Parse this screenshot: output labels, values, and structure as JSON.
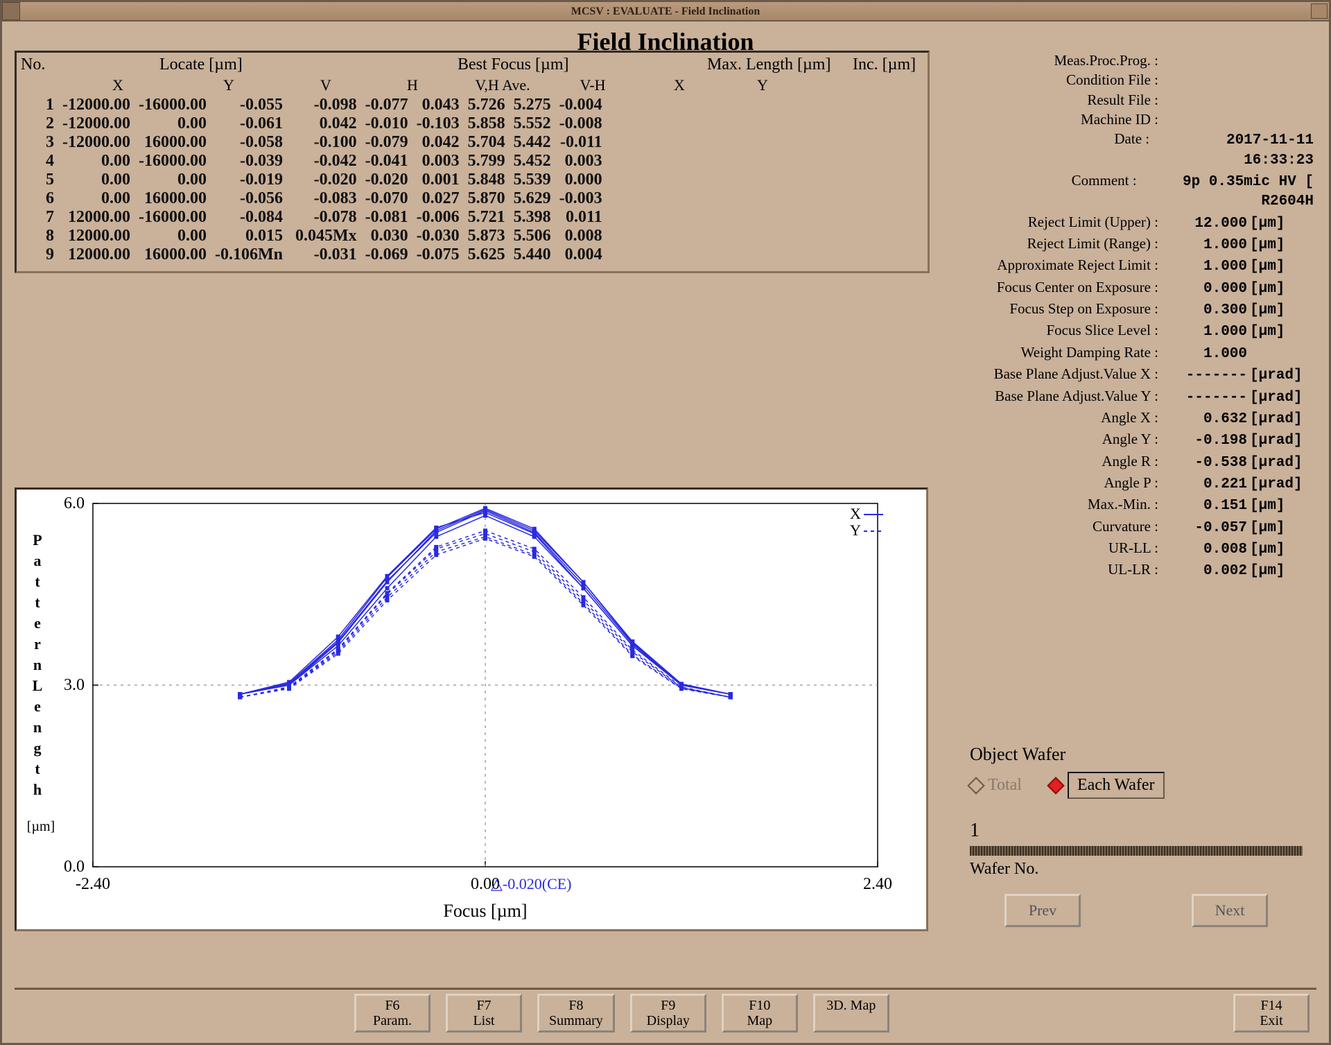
{
  "window_title": "MCSV : EVALUATE - Field Inclination",
  "page_title": "Field Inclination",
  "group_headers": {
    "no": "No.",
    "locate": "Locate [µm]",
    "best_focus": "Best Focus [µm]",
    "max_length": "Max. Length [µm]",
    "inc": "Inc. [µm]"
  },
  "col_headers": {
    "x1": "X",
    "y1": "Y",
    "v": "V",
    "h": "H",
    "vhave": "V,H Ave.",
    "vmh": "V-H",
    "x2": "X",
    "y2": "Y"
  },
  "table_rows": [
    {
      "no": "1",
      "lx": "-12000.00",
      "ly": "-16000.00",
      "v": "-0.055",
      "h": "-0.098",
      "vhave": "-0.077",
      "vmh": " 0.043",
      "mx": "5.726",
      "my": "5.275",
      "inc": "-0.004"
    },
    {
      "no": "2",
      "lx": "-12000.00",
      "ly": "     0.00",
      "v": "-0.061",
      "h": " 0.042",
      "vhave": "-0.010",
      "vmh": "-0.103",
      "mx": "5.858",
      "my": "5.552",
      "inc": "-0.008"
    },
    {
      "no": "3",
      "lx": "-12000.00",
      "ly": " 16000.00",
      "v": "-0.058",
      "h": "-0.100",
      "vhave": "-0.079",
      "vmh": " 0.042",
      "mx": "5.704",
      "my": "5.442",
      "inc": "-0.011"
    },
    {
      "no": "4",
      "lx": "     0.00",
      "ly": "-16000.00",
      "v": "-0.039",
      "h": "-0.042",
      "vhave": "-0.041",
      "vmh": " 0.003",
      "mx": "5.799",
      "my": "5.452",
      "inc": " 0.003"
    },
    {
      "no": "5",
      "lx": "     0.00",
      "ly": "     0.00",
      "v": "-0.019",
      "h": "-0.020",
      "vhave": "-0.020",
      "vmh": " 0.001",
      "mx": "5.848",
      "my": "5.539",
      "inc": " 0.000"
    },
    {
      "no": "6",
      "lx": "     0.00",
      "ly": " 16000.00",
      "v": "-0.056",
      "h": "-0.083",
      "vhave": "-0.070",
      "vmh": " 0.027",
      "mx": "5.870",
      "my": "5.629",
      "inc": "-0.003"
    },
    {
      "no": "7",
      "lx": " 12000.00",
      "ly": "-16000.00",
      "v": "-0.084",
      "h": "-0.078",
      "vhave": "-0.081",
      "vmh": "-0.006",
      "mx": "5.721",
      "my": "5.398",
      "inc": " 0.011"
    },
    {
      "no": "8",
      "lx": " 12000.00",
      "ly": "     0.00",
      "v": " 0.015",
      "h": " 0.045Mx",
      "vhave": " 0.030",
      "vmh": "-0.030",
      "mx": "5.873",
      "my": "5.506",
      "inc": " 0.008"
    },
    {
      "no": "9",
      "lx": " 12000.00",
      "ly": " 16000.00",
      "v": "-0.106Mn",
      "h": "-0.031",
      "vhave": "-0.069",
      "vmh": "-0.075",
      "mx": "5.625",
      "my": "5.440",
      "inc": " 0.004"
    }
  ],
  "side": [
    {
      "label": "Meas.Proc.Prog. :",
      "value": "",
      "unit": ""
    },
    {
      "label": "Condition File :",
      "value": "",
      "unit": ""
    },
    {
      "label": "Result File :",
      "value": "",
      "unit": ""
    },
    {
      "label": "Machine ID :",
      "value": "",
      "unit": ""
    },
    {
      "label": "Date :",
      "value": "2017-11-11 16:33:23",
      "unit": ""
    },
    {
      "label": "Comment :",
      "value": "9p 0.35mic HV [ R2604H",
      "unit": ""
    },
    {
      "label": "Reject Limit (Upper) :",
      "value": "12.000",
      "unit": "[µm]"
    },
    {
      "label": "Reject Limit (Range) :",
      "value": "1.000",
      "unit": "[µm]"
    },
    {
      "label": "Approximate Reject Limit :",
      "value": "1.000",
      "unit": "[µm]"
    },
    {
      "label": "Focus Center on Exposure :",
      "value": "0.000",
      "unit": "[µm]"
    },
    {
      "label": "Focus Step on Exposure :",
      "value": "0.300",
      "unit": "[µm]"
    },
    {
      "label": "Focus Slice Level :",
      "value": "1.000",
      "unit": "[µm]"
    },
    {
      "label": "Weight Damping Rate :",
      "value": "1.000",
      "unit": ""
    },
    {
      "label": "Base Plane Adjust.Value X :",
      "value": "-------",
      "unit": "[µrad]"
    },
    {
      "label": "Base Plane Adjust.Value Y :",
      "value": "-------",
      "unit": "[µrad]"
    },
    {
      "label": "Angle X :",
      "value": "0.632",
      "unit": "[µrad]"
    },
    {
      "label": "Angle Y :",
      "value": "-0.198",
      "unit": "[µrad]"
    },
    {
      "label": "Angle R :",
      "value": "-0.538",
      "unit": "[µrad]"
    },
    {
      "label": "Angle P :",
      "value": "0.221",
      "unit": "[µrad]"
    },
    {
      "label": "Max.-Min. :",
      "value": "0.151",
      "unit": "[µm]"
    },
    {
      "label": "Curvature :",
      "value": "-0.057",
      "unit": "[µm]"
    },
    {
      "label": "UR-LL :",
      "value": "0.008",
      "unit": "[µm]"
    },
    {
      "label": "UL-LR :",
      "value": "0.002",
      "unit": "[µm]"
    }
  ],
  "object_wafer": {
    "title": "Object Wafer",
    "total": "Total",
    "each": "Each Wafer",
    "selected": "each",
    "wafer_num": "1",
    "wafer_label": "Wafer No.",
    "prev": "Prev",
    "next": "Next"
  },
  "fn_buttons": [
    {
      "key": "F6",
      "label": "Param."
    },
    {
      "key": "F7",
      "label": "List"
    },
    {
      "key": "F8",
      "label": "Summary"
    },
    {
      "key": "F9",
      "label": "Display"
    },
    {
      "key": "F10",
      "label": "Map"
    },
    {
      "key": "",
      "label": "3D. Map"
    }
  ],
  "exit_btn": {
    "key": "F14",
    "label": "Exit"
  },
  "chart_data": {
    "type": "line",
    "title": "",
    "xlabel": "Focus [µm]",
    "ylabel": "Pattern Length",
    "yunit": "[µm]",
    "xlim": [
      -2.4,
      2.4
    ],
    "ylim": [
      0.0,
      6.0
    ],
    "xticks": [
      -2.4,
      0.0,
      2.4
    ],
    "yticks": [
      0.0,
      3.0,
      6.0
    ],
    "center_annotation": "-0.020(CE)",
    "legend": [
      "X",
      "Y"
    ],
    "x": [
      -1.5,
      -1.2,
      -0.9,
      -0.6,
      -0.3,
      0.0,
      0.3,
      0.6,
      0.9,
      1.2,
      1.5
    ],
    "series": [
      {
        "name": "X1",
        "style": "solid",
        "values": [
          2.85,
          3.0,
          3.7,
          4.7,
          5.55,
          5.9,
          5.55,
          4.7,
          3.7,
          3.0,
          2.85
        ]
      },
      {
        "name": "X2",
        "style": "solid",
        "values": [
          2.85,
          3.05,
          3.8,
          4.8,
          5.6,
          5.85,
          5.5,
          4.6,
          3.65,
          3.0,
          2.85
        ]
      },
      {
        "name": "X3",
        "style": "solid",
        "values": [
          2.85,
          3.0,
          3.65,
          4.6,
          5.45,
          5.8,
          5.45,
          4.6,
          3.65,
          3.0,
          2.85
        ]
      },
      {
        "name": "X4",
        "style": "solid",
        "values": [
          2.85,
          3.02,
          3.72,
          4.72,
          5.52,
          5.88,
          5.52,
          4.65,
          3.68,
          3.0,
          2.85
        ]
      },
      {
        "name": "X5",
        "style": "solid",
        "values": [
          2.85,
          3.03,
          3.75,
          4.78,
          5.58,
          5.92,
          5.58,
          4.7,
          3.72,
          3.02,
          2.85
        ]
      },
      {
        "name": "Y1",
        "style": "dash",
        "values": [
          2.8,
          2.95,
          3.55,
          4.45,
          5.2,
          5.45,
          5.15,
          4.35,
          3.5,
          2.95,
          2.8
        ]
      },
      {
        "name": "Y2",
        "style": "dash",
        "values": [
          2.8,
          2.96,
          3.58,
          4.5,
          5.25,
          5.5,
          5.2,
          4.4,
          3.55,
          2.96,
          2.8
        ]
      },
      {
        "name": "Y3",
        "style": "dash",
        "values": [
          2.8,
          2.94,
          3.52,
          4.4,
          5.15,
          5.42,
          5.12,
          4.32,
          3.48,
          2.94,
          2.8
        ]
      },
      {
        "name": "Y4",
        "style": "dash",
        "values": [
          2.8,
          2.97,
          3.6,
          4.52,
          5.28,
          5.55,
          5.25,
          4.45,
          3.58,
          2.97,
          2.8
        ]
      }
    ]
  }
}
